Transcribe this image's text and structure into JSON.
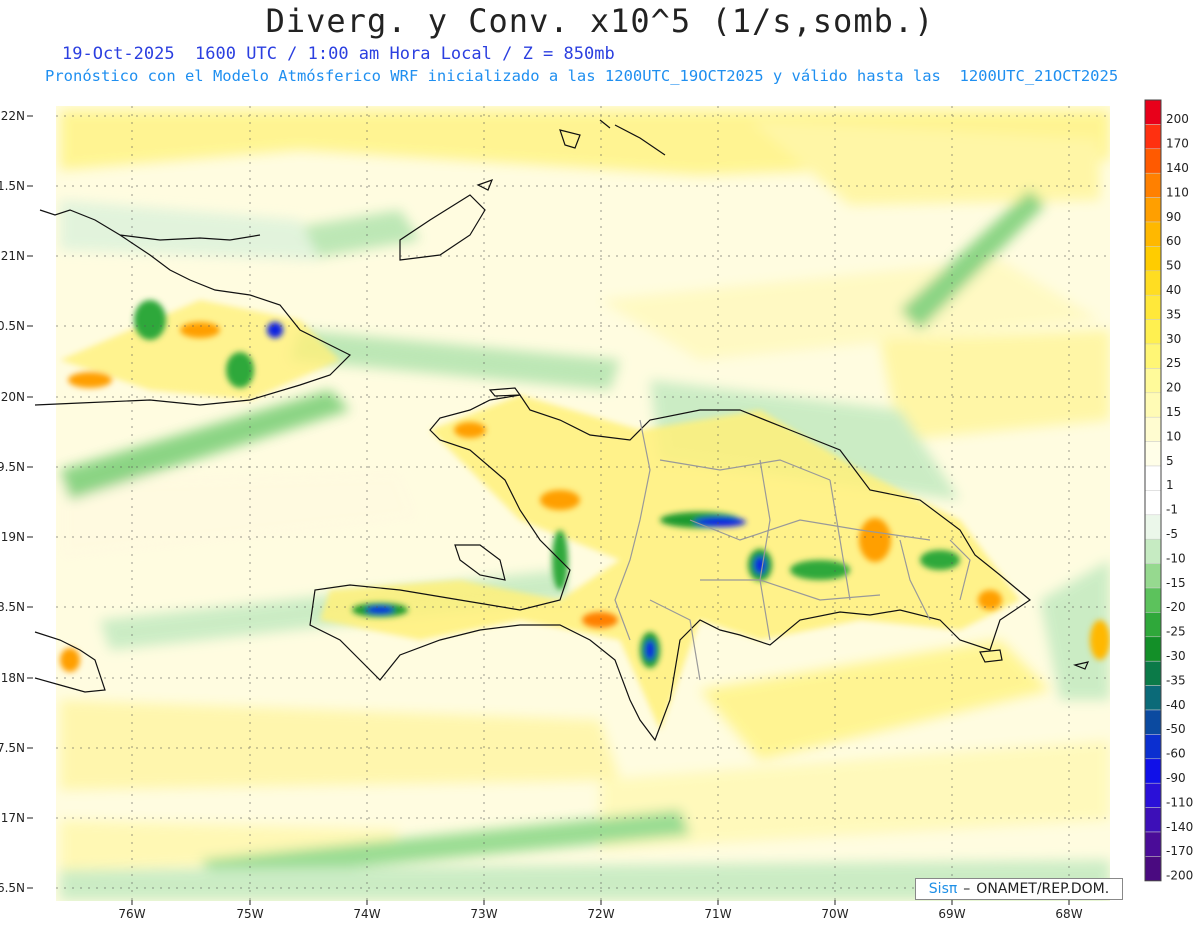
{
  "title": "Diverg. y Conv. x10^5 (1/s,somb.)",
  "subtitle_line1": "19-Oct-2025  1600 UTC / 1:00 am Hora Local / Z = 850mb",
  "subtitle_line2": "Pronóstico con el Modelo Atmósferico WRF inicializado a las 1200UTC_19OCT2025 y válido hasta las  1200UTC_21OCT2025",
  "credit": {
    "logo_text": "Sisπ",
    "text": "ONAMET/REP.DOM."
  },
  "lat_labels": [
    "22N",
    "1.5N",
    "21N",
    "0.5N",
    "20N",
    "9.5N",
    "19N",
    "8.5N",
    "18N",
    "7.5N",
    "17N",
    "6.5N"
  ],
  "lon_labels": [
    "76W",
    "75W",
    "74W",
    "73W",
    "72W",
    "71W",
    "70W",
    "69W",
    "68W"
  ],
  "colorbar": {
    "labels": [
      "200",
      "170",
      "140",
      "110",
      "90",
      "60",
      "50",
      "40",
      "35",
      "30",
      "25",
      "20",
      "15",
      "10",
      "5",
      "1",
      "-1",
      "-5",
      "-10",
      "-15",
      "-20",
      "-25",
      "-30",
      "-35",
      "-40",
      "-50",
      "-60",
      "-90",
      "-110",
      "-140",
      "-170",
      "-200"
    ],
    "colors": [
      "#e8001a",
      "#ff3010",
      "#ff5a00",
      "#ff8000",
      "#ff9f00",
      "#ffb800",
      "#ffcc00",
      "#ffdd22",
      "#ffe83a",
      "#fff050",
      "#fff675",
      "#fffa9a",
      "#fffbb5",
      "#fffcd0",
      "#fffee8",
      "#ffffff",
      "#ffffff",
      "#ebf7ea",
      "#c6ebc2",
      "#96d98f",
      "#5cc25c",
      "#2fa83a",
      "#138f28",
      "#0b7a48",
      "#0b6a78",
      "#0b4aa0",
      "#0b2fd0",
      "#1010e8",
      "#2a10d8",
      "#3d0fb8",
      "#4a0c98",
      "#4a0a80"
    ]
  },
  "colors": {
    "title": "#222222",
    "subtitle_blue": "#2b3fe0",
    "subtitle_cyan": "#1f8ff0"
  }
}
